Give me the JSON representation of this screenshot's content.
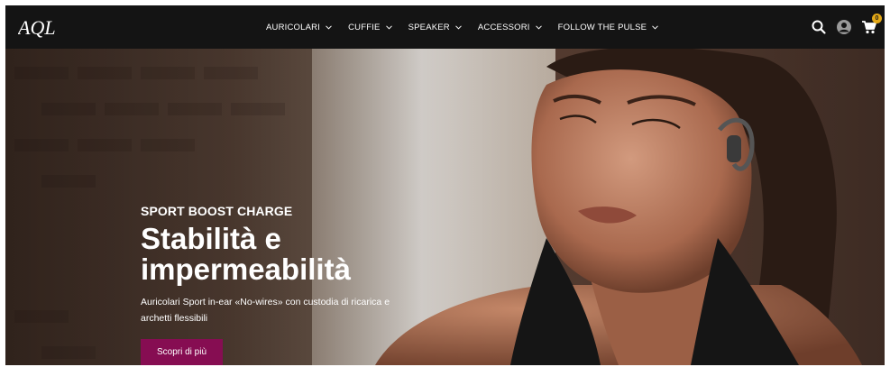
{
  "brand": {
    "logo_text": "AQL"
  },
  "nav": {
    "items": [
      {
        "label": "AURICOLARI"
      },
      {
        "label": "CUFFIE"
      },
      {
        "label": "SPEAKER"
      },
      {
        "label": "ACCESSORI"
      },
      {
        "label": "FOLLOW THE PULSE"
      }
    ]
  },
  "header_icons": {
    "search": "search-icon",
    "account": "user-icon",
    "cart": "cart-icon",
    "cart_count": "0"
  },
  "hero": {
    "eyebrow": "SPORT BOOST CHARGE",
    "headline": "Stabilità e impermeabilità",
    "description": "Auricolari Sport in-ear «No-wires» con custodia di ricarica e archetti flessibili",
    "cta_label": "Scopri di più"
  },
  "colors": {
    "header_bg": "#141414",
    "cta_bg": "#860d52",
    "badge_bg": "#e3a817"
  }
}
